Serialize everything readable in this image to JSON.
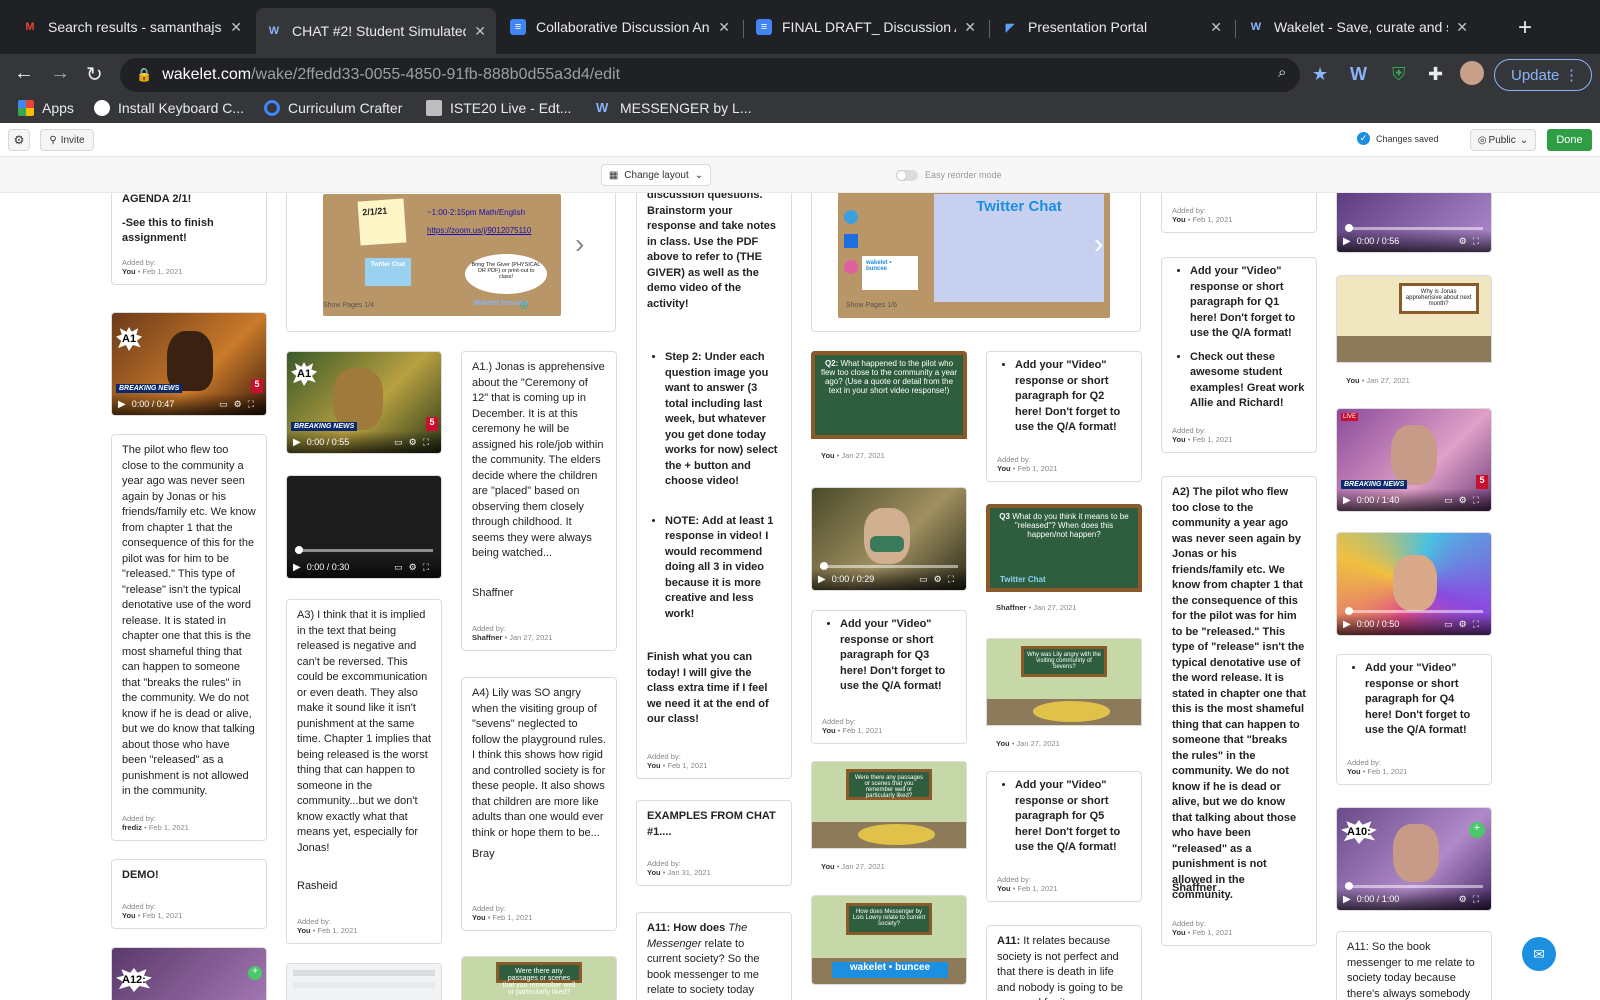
{
  "browser": {
    "tabs": [
      {
        "title": "Search results - samanthajsh",
        "icon": "gmail-icon",
        "color": "#ea4335",
        "glyph": "M"
      },
      {
        "title": "CHAT #2! Student Simulated",
        "icon": "wakelet-icon",
        "color": "#8ab4f8",
        "glyph": "W"
      },
      {
        "title": "Collaborative Discussion Ana",
        "icon": "docs-icon",
        "color": "#4285f4",
        "glyph": "≡"
      },
      {
        "title": "FINAL DRAFT_ Discussion An",
        "icon": "docs-icon",
        "color": "#4285f4",
        "glyph": "≡"
      },
      {
        "title": "Presentation Portal",
        "icon": "portal-icon",
        "color": "#5aa0ff",
        "glyph": "◤"
      },
      {
        "title": "Wakelet - Save, curate and s",
        "icon": "wakelet-icon",
        "color": "#8ab4f8",
        "glyph": "W"
      }
    ],
    "url_domain": "wakelet.com",
    "url_path": "/wake/2ffedd33-0055-4850-91fb-888b0d55a3d4/edit",
    "update_label": "Update",
    "bookmarks": [
      {
        "label": "Apps",
        "color": "#ea4335"
      },
      {
        "label": "Install Keyboard C...",
        "color": "#ffffff"
      },
      {
        "label": "Curriculum Crafter",
        "color": "#4285f4"
      },
      {
        "label": "ISTE20 Live - Edt...",
        "color": "#bdbdbd"
      },
      {
        "label": "MESSENGER by L...",
        "color": "#8ab4f8"
      }
    ]
  },
  "wakelet": {
    "invite_label": "Invite",
    "changes_saved": "Changes saved",
    "visibility": "Public",
    "done_label": "Done",
    "change_layout": "Change layout",
    "reorder_mode": "Easy reorder mode"
  },
  "cards": {
    "agenda_text": "AGENDA 2/1!",
    "agenda_sub": "-See this to finish assignment!",
    "added_by": "Added by:",
    "you": "You",
    "feb1": "Feb 1, 2021",
    "jan27": "Jan 27, 2021",
    "jan31": "Jan 31, 2021",
    "shaffner": "Shaffner",
    "frediz": "frediz",
    "t_pilot": "The pilot who flew too close to the community a year ago was never seen again by Jonas or his friends/family etc. We know from chapter 1 that the consequence of this for the pilot was for him to be \"released.\" This type of \"release\" isn't the typical denotative use of the word release. It is stated in chapter one that this is the most shameful thing that can happen to someone that \"breaks the rules\" in the community. We do not know if he is dead or alive, but we do know that talking about those who have been \"released\" as a punishment is not allowed in the community.",
    "t_demo": "DEMO!",
    "t_a3": "A3) I think that it is implied in the text that being released is negative and can't be reversed. This could be excommunication or even death. They also make it sound like it isn't punishment at the same time. Chapter 1 implies that being released is the worst thing that can happen to someone in the community...but we don't know exactly what that means yet, especially for Jonas!",
    "sig_rasheid": "Rasheid",
    "t_a1": "A1.) Jonas is apprehensive about the \"Ceremony of 12\" that is coming up in December. It is at this ceremony he will be assigned his role/job within the community. The elders decide where the children are \"placed\" based on observing them closely through childhood. It seems they were always being watched...",
    "sig_shaffner": "Shaffner",
    "t_a4": "A4) Lily was SO angry when the visiting group of \"sevens\" neglected to follow the playground rules. I think this shows how rigid and controlled society is for these people. It also shows that children are more like adults than one would ever think or hope them to be...",
    "sig_bray": "Bray",
    "t_instr_top": "discussion questions. Brainstorm your response and take notes in class. Use the PDF above to refer to (THE GIVER) as well as the demo video of the activity!",
    "t_step2": "Step 2: Under each question image you want to answer (3 total including last week, but whatever you get done today works for now) select the + button and choose video!",
    "t_note": "NOTE: Add at least 1 response in video! I would recommend doing all 3 in video because it is more creative and less work!",
    "t_finish": "Finish what you can today! I will give the class extra time if I feel we need it at the end of our class!",
    "t_examples": "EXAMPLES FROM CHAT #1....",
    "t_a11_pre": "A11: How does ",
    "t_a11_em": "The Messenger",
    "t_a11_post": " relate to current society? So the book messenger to me relate to society today because",
    "t_q1": "Add your \"Video\" response or short paragraph for Q1 here! Don't forget to use the Q/A format!",
    "t_q2": "Add your \"Video\" response or short paragraph for Q2 here! Don't forget to use the Q/A format!",
    "t_q3": "Add your \"Video\" response or short paragraph for Q3 here! Don't forget to use the Q/A format!",
    "t_q4": "Add your \"Video\" response or short paragraph for Q4 here! Don't forget to use the Q/A format!",
    "t_q5": "Add your \"Video\" response or short paragraph for Q5 here! Don't forget to use the Q/A format!",
    "t_check": "Check out these awesome student examples! Great work Allie and Richard!",
    "t_a2": "A2) The pilot who flew too close to the community a year ago was never seen again by Jonas or his friends/family etc. We know from chapter 1 that the consequence of this for the pilot was for him to be \"released.\" This type of \"release\" isn't the typical denotative use of the word release. It is stated in chapter one that this is the most shameful thing that can happen to someone that \"breaks the rules\" in the community. We do not know if he is dead or alive, but we do know that talking about those who have been \"released\" as a punishment is not allowed in the community.",
    "t_a11b_pre": "A11:",
    "t_a11b": " It relates because society is not perfect and that there is death in life and nobody is going to be prepared for it",
    "t_a11c": "A11: So the book messenger to me relate to society today because there's always somebody",
    "show_pages_1": "Show Pages 1/4",
    "show_pages_2": "Show Pages 1/6",
    "twitter_chat": "Twitter Chat",
    "slide_date": "2/1/21",
    "slide_time": "~1:00-2:15pm Math/English",
    "slide_link": "https://zoom.us/j/9012075110",
    "slide_giver": "Bring The Giver (PHYSICAL OR PDF) or print-out to class!",
    "wakelet_session": "Wakelet Session",
    "q2_text": "What happened to the pilot who flew too close to the community a year ago? (Use a quote or detail from the text in your short video response!)",
    "q3_text": "What do you think it means to be \"released\"? When does this happen/not happen?",
    "q4_text": "Why was Lily angry with the visiting community of Sevens?",
    "q5_text": "Were there any passages or scenes that you remember well or particularly liked?",
    "q11_text": "How does Messenger by Lois Lowry relate to current society?",
    "q12_text": "Were there any passages or scenes that you remember well or particularly liked?",
    "q1_text": "Why is Jonas apprehensive about next month?",
    "wakelet_buncee": "wakelet • buncee",
    "badges": {
      "a1": "A1",
      "a1b": "A1",
      "a10": "A10:",
      "a12": "A12:"
    },
    "breaking": "BREAKING NEWS",
    "times": {
      "v1": "0:00 / 0:47",
      "v2": "0:00 / 0:55",
      "v3": "0:00 / 0:30",
      "v4": "0:00 / 0:29",
      "v5": "0:00 / 0:56",
      "v6": "0:00 / 1:40",
      "v7": "0:00 / 0:50",
      "v8": "0:00 / 1:00"
    },
    "live": "LIVE"
  },
  "colors": {
    "accent": "#2e9e44",
    "chalkboard": "#2f5e3e",
    "link": "#1a0dab"
  }
}
